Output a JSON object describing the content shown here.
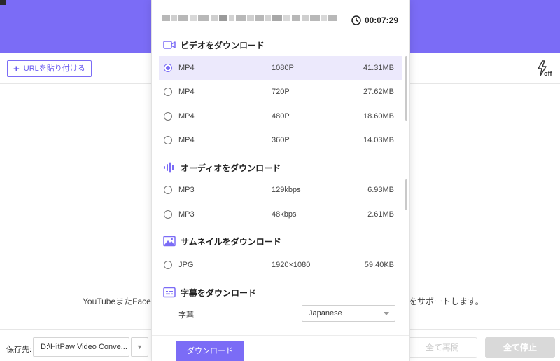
{
  "toolbar": {
    "paste_url_label": "URLを貼り付ける"
  },
  "background": {
    "hint_left": "YouTubeまたFaceb",
    "hint_right": "をサポートします。"
  },
  "footer": {
    "save_label": "保存先:",
    "save_path": "D:\\HitPaw Video Conve...",
    "resume_all": "全て再開",
    "stop_all": "全て停止"
  },
  "dialog": {
    "duration": "00:07:29",
    "sections": {
      "video": "ビデオをダウンロード",
      "audio": "オーディオをダウンロード",
      "thumbnail": "サムネイルをダウンロード",
      "subtitle": "字幕をダウンロード"
    },
    "video_options": [
      {
        "format": "MP4",
        "quality": "1080P",
        "size": "41.31MB",
        "selected": true
      },
      {
        "format": "MP4",
        "quality": "720P",
        "size": "27.62MB",
        "selected": false
      },
      {
        "format": "MP4",
        "quality": "480P",
        "size": "18.60MB",
        "selected": false
      },
      {
        "format": "MP4",
        "quality": "360P",
        "size": "14.03MB",
        "selected": false
      }
    ],
    "audio_options": [
      {
        "format": "MP3",
        "quality": "129kbps",
        "size": "6.93MB",
        "selected": false
      },
      {
        "format": "MP3",
        "quality": "48kbps",
        "size": "2.61MB",
        "selected": false
      }
    ],
    "thumbnail_options": [
      {
        "format": "JPG",
        "quality": "1920×1080",
        "size": "59.40KB",
        "selected": false
      }
    ],
    "subtitle": {
      "label": "字幕",
      "value": "Japanese"
    },
    "download_label": "ダウンロード"
  },
  "colors": {
    "accent": "#7b6cf6",
    "selected_row": "#ece9fc",
    "header_bg": "#7b6cf6"
  },
  "icons": [
    "clock-icon",
    "video-camera-icon",
    "audio-wave-icon",
    "image-icon",
    "subtitle-icon",
    "turbo-off-icon",
    "chevron-down-icon"
  ]
}
